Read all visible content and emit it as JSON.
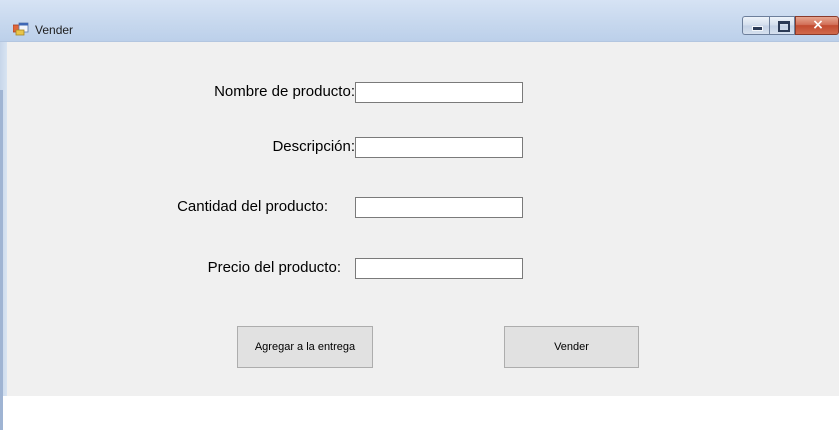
{
  "window": {
    "title": "Vender",
    "icon": "form-window-icon",
    "controls": {
      "minimize": "minimize-icon",
      "maximize": "maximize-icon",
      "close": "close-icon",
      "close_glyph": "×"
    }
  },
  "form": {
    "fields": [
      {
        "label": "Nombre de producto:",
        "value": ""
      },
      {
        "label": "Descripción:",
        "value": ""
      },
      {
        "label": "Cantidad del producto:",
        "value": ""
      },
      {
        "label": "Precio del producto:",
        "value": ""
      }
    ],
    "buttons": {
      "add_label": "Agregar a la entrega",
      "sell_label": "Vender"
    }
  },
  "colors": {
    "titlebar": "#c7d8ee",
    "client_background": "#f0f0f0",
    "button_face": "#e1e1e1",
    "close_button": "#c24a30"
  }
}
